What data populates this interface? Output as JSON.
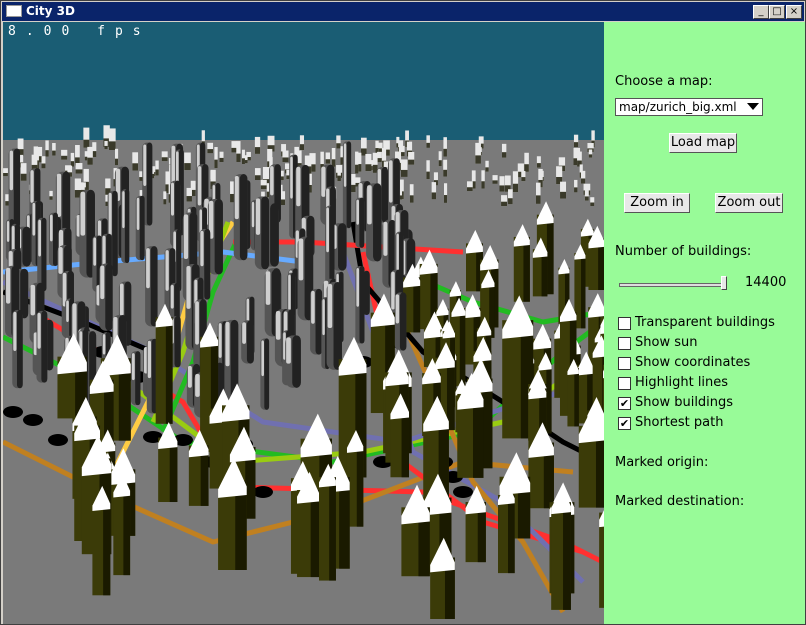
{
  "window": {
    "title": "City 3D",
    "minimize": "_",
    "maximize": "□",
    "close": "×"
  },
  "viewport": {
    "fps_text": "8.00 fps",
    "sky_color": "#1a5d74",
    "ground_color": "#7a7a7a"
  },
  "panel": {
    "background": "#98fb98",
    "choose_map_label": "Choose a map:",
    "map_select_value": "map/zurich_big.xml",
    "load_map_button": "Load map",
    "zoom_in_button": "Zoom in",
    "zoom_out_button": "Zoom out",
    "buildings_label": "Number of buildings:",
    "buildings_count": "14400",
    "buildings_slider_fraction": 0.98,
    "checkboxes": [
      {
        "label": "Transparent buildings",
        "checked": false
      },
      {
        "label": "Show sun",
        "checked": false
      },
      {
        "label": "Show coordinates",
        "checked": false
      },
      {
        "label": "Highlight lines",
        "checked": false
      },
      {
        "label": "Show buildings",
        "checked": true
      },
      {
        "label": "Shortest path",
        "checked": true
      }
    ],
    "marked_origin_label": "Marked origin:",
    "marked_destination_label": "Marked destination:"
  }
}
